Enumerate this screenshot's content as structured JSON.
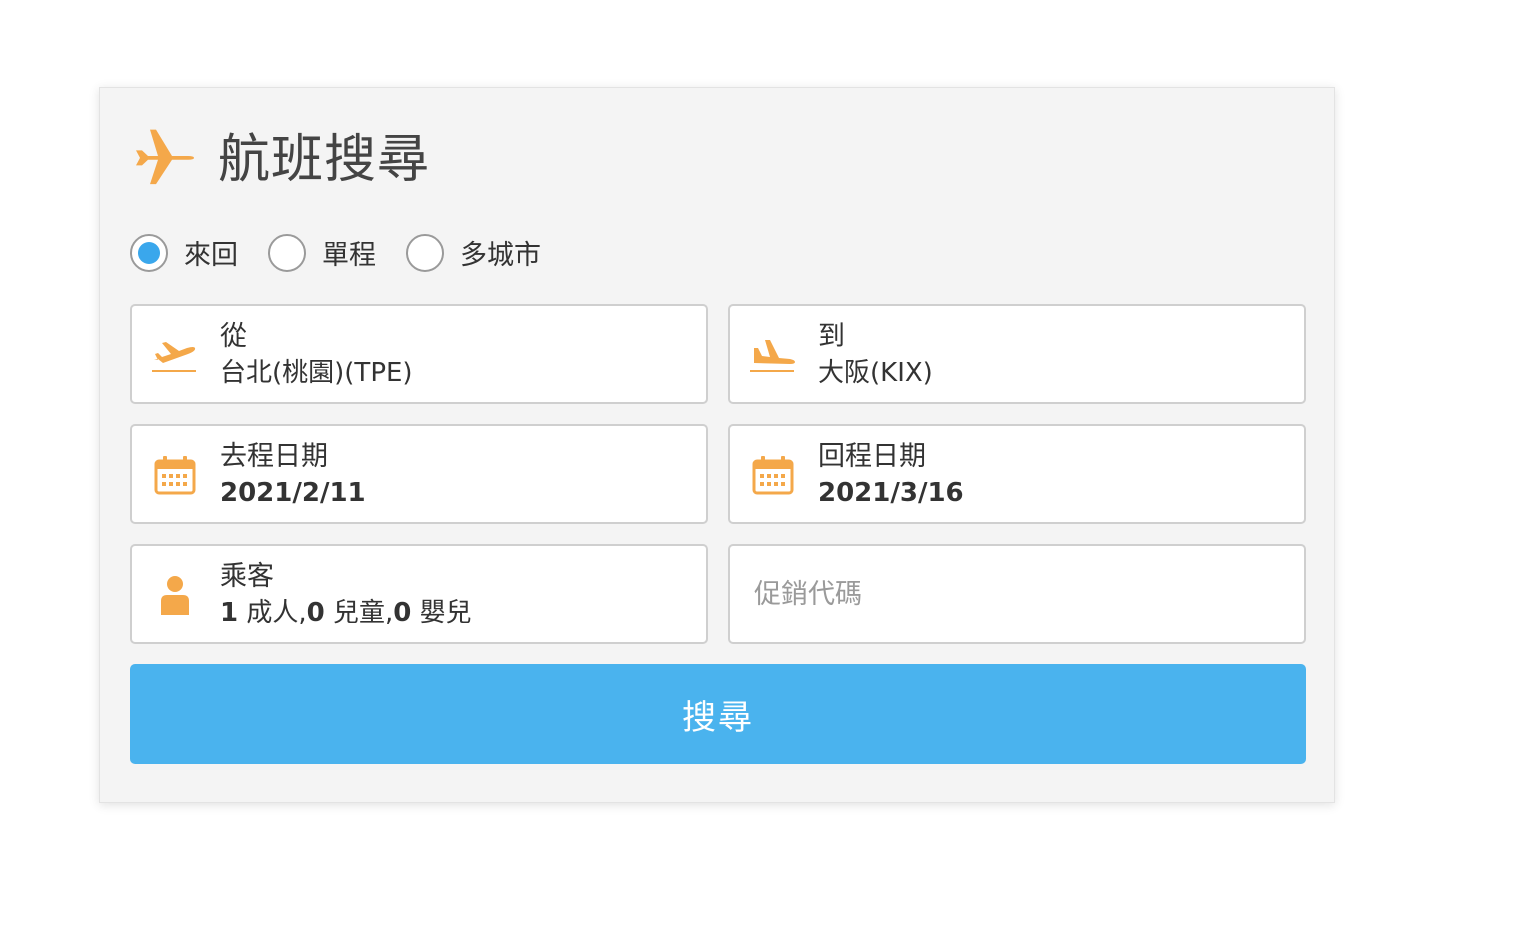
{
  "header": {
    "title": "航班搜尋",
    "icon": "airplane-icon"
  },
  "trip_types": [
    {
      "label": "來回",
      "selected": true
    },
    {
      "label": "單程",
      "selected": false
    },
    {
      "label": "多城市",
      "selected": false
    }
  ],
  "from": {
    "label": "從",
    "value": "台北(桃園)(TPE)",
    "icon": "takeoff-icon"
  },
  "to": {
    "label": "到",
    "value": "大阪(KIX)",
    "icon": "landing-icon"
  },
  "depart_date": {
    "label": "去程日期",
    "value": "2021/2/11",
    "icon": "calendar-icon"
  },
  "return_date": {
    "label": "回程日期",
    "value": "2021/3/16",
    "icon": "calendar-icon"
  },
  "passengers": {
    "label": "乘客",
    "adults_count": "1",
    "adults_label": " 成人,",
    "children_count": "0",
    "children_label": " 兒童,",
    "infants_count": "0",
    "infants_label": " 嬰兒",
    "icon": "person-icon"
  },
  "promo": {
    "placeholder": "促銷代碼"
  },
  "search_button": {
    "label": "搜尋"
  },
  "colors": {
    "accent_orange": "#f4a84a",
    "accent_blue": "#4ab3ee",
    "radio_selected": "#3aa7ec"
  }
}
